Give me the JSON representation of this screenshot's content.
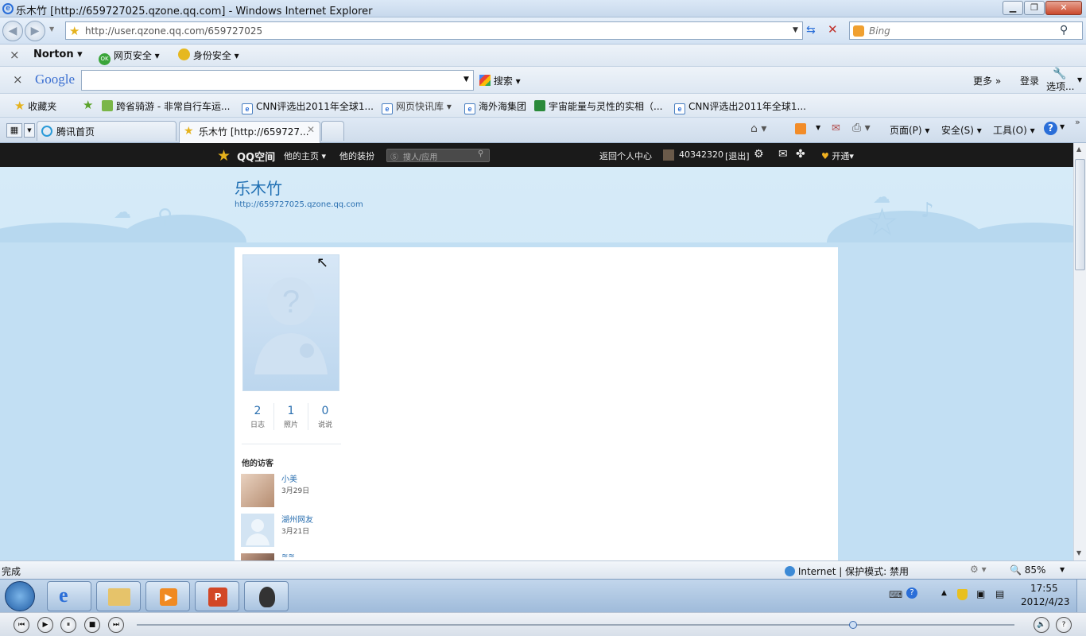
{
  "window": {
    "title": "乐木竹 [http://659727025.qzone.qq.com] - Windows Internet Explorer"
  },
  "nav": {
    "url": "http://user.qzone.qq.com/659727025",
    "search_placeholder": "Bing"
  },
  "norton": {
    "brand": "Norton",
    "web_safety": "网页安全",
    "identity_safety": "身份安全"
  },
  "google": {
    "logo": "Google",
    "search_label": "搜索",
    "more_label": "更多 »",
    "login_label": "登录",
    "options_label": "选项..."
  },
  "favorites": {
    "label": "收藏夹",
    "items": [
      "跨省骑游 - 非常自行车运...",
      "CNN评选出2011年全球1...",
      "网页快讯库",
      "海外海集团",
      "宇宙能量与灵性的实相（...",
      "CNN评选出2011年全球1..."
    ]
  },
  "tabs": [
    {
      "label": "腾讯首页",
      "active": false
    },
    {
      "label": "乐木竹 [http://659727...",
      "active": true
    }
  ],
  "commandbar": {
    "page": "页面(P)",
    "safety": "安全(S)",
    "tools": "工具(O)"
  },
  "qzone": {
    "logo": "QQ空间",
    "his_home": "他的主页",
    "his_outfit": "他的装扮",
    "search_placeholder": "搜人/应用",
    "back_center": "返回个人中心",
    "user_id": "40342320",
    "logout": "[退出]",
    "open_vip": "开通"
  },
  "profile": {
    "name": "乐木竹",
    "url": "http://659727025.qzone.qq.com",
    "stats": [
      {
        "num": "2",
        "label": "日志"
      },
      {
        "num": "1",
        "label": "照片"
      },
      {
        "num": "0",
        "label": "说说"
      }
    ],
    "visitors_title": "他的访客",
    "visitors": [
      {
        "name": "小美",
        "date": "3月29日"
      },
      {
        "name": "湖州网友",
        "date": "3月21日"
      },
      {
        "name": "≈≈",
        "date": ""
      }
    ]
  },
  "status": {
    "left": "完成",
    "zone": "Internet | 保护模式: 禁用",
    "zoom": "85%"
  },
  "clock": {
    "time": "17:55",
    "date": "2012/4/23"
  }
}
